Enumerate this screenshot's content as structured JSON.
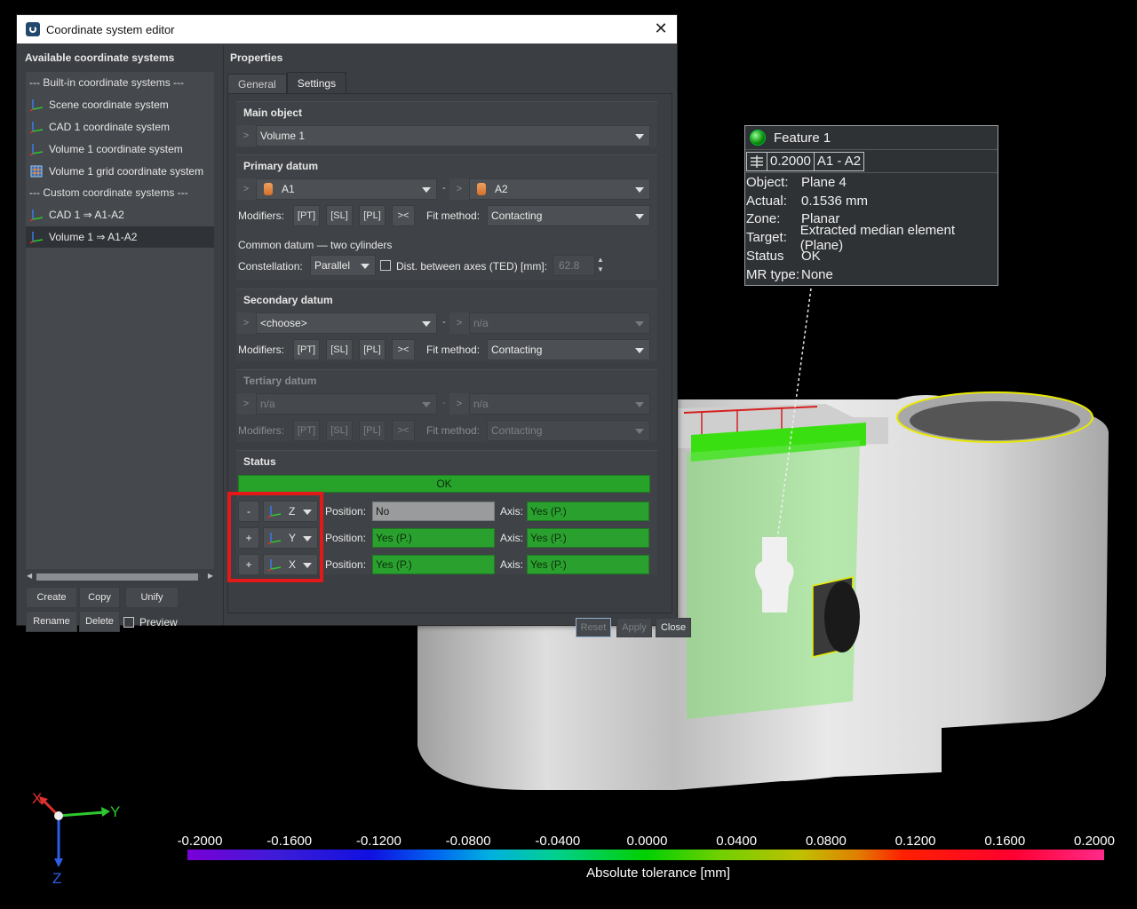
{
  "dialog": {
    "title": "Coordinate system editor",
    "close_glyph": "✕",
    "left": {
      "title": "Available coordinate systems",
      "items": [
        {
          "label": "--- Built-in coordinate systems ---",
          "kind": "header"
        },
        {
          "label": "Scene coordinate system",
          "kind": "axes-icon"
        },
        {
          "label": "CAD 1 coordinate system",
          "kind": "axes-icon"
        },
        {
          "label": "Volume 1 coordinate system",
          "kind": "axes-icon"
        },
        {
          "label": "Volume 1 grid coordinate system",
          "kind": "grid-icon"
        },
        {
          "label": "--- Custom coordinate systems ---",
          "kind": "header"
        },
        {
          "label": "CAD 1 ⇒ A1-A2",
          "kind": "axes-icon"
        },
        {
          "label": "Volume 1 ⇒ A1-A2",
          "kind": "axes-icon",
          "selected": true
        }
      ],
      "buttons": {
        "create": "Create",
        "copy": "Copy",
        "unify": "Unify",
        "rename": "Rename",
        "delete": "Delete"
      },
      "preview_label": "Preview"
    },
    "right": {
      "title": "Properties",
      "tabs": {
        "general": "General",
        "settings": "Settings"
      },
      "main_object": {
        "title": "Main object",
        "value": "Volume 1"
      },
      "primary": {
        "title": "Primary datum",
        "a": "A1",
        "b": "A2",
        "modifiers_label": "Modifiers:",
        "mods": [
          "[PT]",
          "[SL]",
          "[PL]",
          "><"
        ],
        "fit_label": "Fit method:",
        "fit_value": "Contacting",
        "common": "Common datum — two cylinders",
        "constellation_label": "Constellation:",
        "constellation_value": "Parallel",
        "ted_label": "Dist. between axes (TED)  [mm]:",
        "ted_value": "62.8"
      },
      "secondary": {
        "title": "Secondary datum",
        "a": "<choose>",
        "b": "n/a",
        "modifiers_label": "Modifiers:",
        "mods": [
          "[PT]",
          "[SL]",
          "[PL]",
          "><"
        ],
        "fit_label": "Fit method:",
        "fit_value": "Contacting"
      },
      "tertiary": {
        "title": "Tertiary datum",
        "a": "n/a",
        "b": "n/a",
        "modifiers_label": "Modifiers:",
        "mods": [
          "[PT]",
          "[SL]",
          "[PL]",
          "><"
        ],
        "fit_label": "Fit method:",
        "fit_value": "Contacting"
      },
      "status": {
        "title": "Status",
        "value": "OK",
        "rows": [
          {
            "sign": "-",
            "axis": "Z",
            "position_label": "Position:",
            "position": "No",
            "axis_label": "Axis:",
            "axis_value": "Yes (P.)"
          },
          {
            "sign": "+",
            "axis": "Y",
            "position_label": "Position:",
            "position": "Yes (P.)",
            "axis_label": "Axis:",
            "axis_value": "Yes (P.)"
          },
          {
            "sign": "+",
            "axis": "X",
            "position_label": "Position:",
            "position": "Yes (P.)",
            "axis_label": "Axis:",
            "axis_value": "Yes (P.)"
          }
        ]
      },
      "footer": {
        "reset": "Reset",
        "apply": "Apply",
        "close": "Close"
      },
      "chevron": ">",
      "dash": "-"
    }
  },
  "tooltip": {
    "title": "Feature 1",
    "tolerance": "0.2000",
    "datum_ref": "A1 - A2",
    "rows": [
      {
        "k": "Object:",
        "v": "Plane 4"
      },
      {
        "k": "Actual:",
        "v": "0.1536 mm"
      },
      {
        "k": "Zone:",
        "v": "Planar"
      },
      {
        "k": "Target:",
        "v": "Extracted median element (Plane)"
      },
      {
        "k": "Status",
        "v": "OK"
      },
      {
        "k": "MR type:",
        "v": "None"
      }
    ]
  },
  "colorbar": {
    "ticks": [
      "-0.2000",
      "-0.1600",
      "-0.1200",
      "-0.0800",
      "-0.0400",
      "0.0000",
      "0.0400",
      "0.0800",
      "0.1200",
      "0.1600",
      "0.2000"
    ],
    "label": "Absolute tolerance [mm]",
    "min": -0.2,
    "max": 0.2
  },
  "triad": {
    "x": "X",
    "y": "Y",
    "z": "Z",
    "x_color": "#e03030",
    "y_color": "#2ec82e",
    "z_color": "#2e5ee8"
  },
  "colors": {
    "ok_green": "#27a32a",
    "highlight_red": "#e11919",
    "dialog_bg": "#3b3e42"
  }
}
